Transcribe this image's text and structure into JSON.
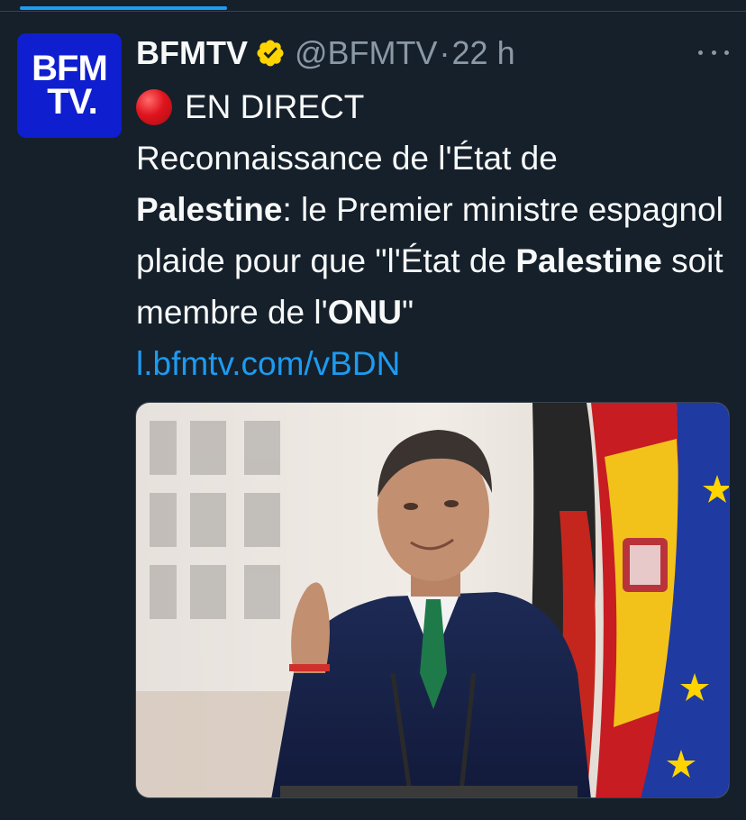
{
  "tweet": {
    "author_name": "BFMTV",
    "handle": "@BFMTV",
    "separator": "·",
    "time": "22 h",
    "avatar_line1": "BFM",
    "avatar_line2": "TV.",
    "live_label": "EN DIRECT",
    "text_1": "Reconnaissance de l'État de",
    "text_bold_1": "Palestine",
    "text_2": ": le Premier ministre espagnol plaide pour que \"l'État de ",
    "text_bold_2": "Palestine",
    "text_3": " soit membre de l'",
    "text_bold_3": "ONU",
    "text_4": "\"",
    "link": "l.bfmtv.com/vBDN"
  },
  "colors": {
    "background": "#15202b",
    "accent": "#1d9bf0",
    "verified_badge": "#ffd400",
    "live_dot": "#e0141e",
    "avatar_bg": "#0f1ecf"
  },
  "icons": {
    "verified": "verified-badge-icon",
    "more": "more-horizontal-icon",
    "live": "red-circle-icon"
  }
}
